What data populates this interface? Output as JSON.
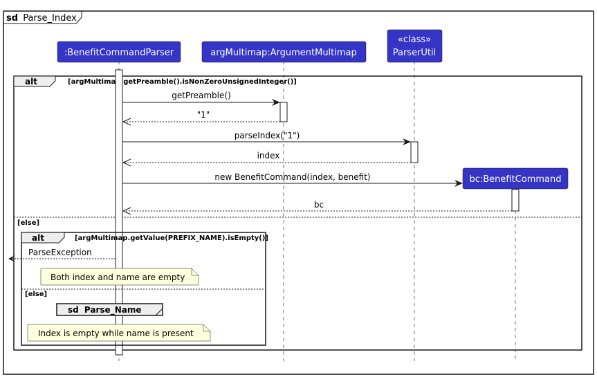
{
  "diagram": {
    "title_kw": "sd",
    "title": "Parse_Index",
    "colors": {
      "participant_fill": "#3434C6",
      "participant_text": "#FFFFFF",
      "note_fill": "#FEFFDD",
      "fragment_header_fill": "#EEEEEE",
      "line": "#181818"
    },
    "participants": [
      {
        "id": "parser",
        "label": ":BenefitCommandParser",
        "stereotype": ""
      },
      {
        "id": "argmm",
        "label": "argMultimap:ArgumentMultimap",
        "stereotype": ""
      },
      {
        "id": "util",
        "label": "ParserUtil",
        "stereotype": "«class»"
      },
      {
        "id": "bc",
        "label": "bc:BenefitCommand",
        "stereotype": ""
      }
    ],
    "outer_alt": {
      "keyword": "alt",
      "guard": "[argMultimap.getPreamble().isNonZeroUnsignedInteger()]",
      "else_label": "[else]"
    },
    "messages": [
      {
        "label": "getPreamble()",
        "from": "parser",
        "to": "argmm",
        "type": "sync"
      },
      {
        "label": "\"1\"",
        "from": "argmm",
        "to": "parser",
        "type": "return"
      },
      {
        "label": "parseIndex(\"1\")",
        "from": "parser",
        "to": "util",
        "type": "sync"
      },
      {
        "label": "index",
        "from": "util",
        "to": "parser",
        "type": "return"
      },
      {
        "label": "new BenefitCommand(index, benefit)",
        "from": "parser",
        "to": "bc",
        "type": "create"
      },
      {
        "label": "bc",
        "from": "bc",
        "to": "parser",
        "type": "return"
      }
    ],
    "inner_alt": {
      "keyword": "alt",
      "guard": "[argMultimap.getValue(PREFIX_NAME).isEmpty()]",
      "else_label": "[else]",
      "exception_label": "ParseException",
      "note1": "Both index and name are empty",
      "ref_kw": "sd",
      "ref_title": "Parse_Name",
      "note2": "Index is empty while name is present"
    }
  }
}
